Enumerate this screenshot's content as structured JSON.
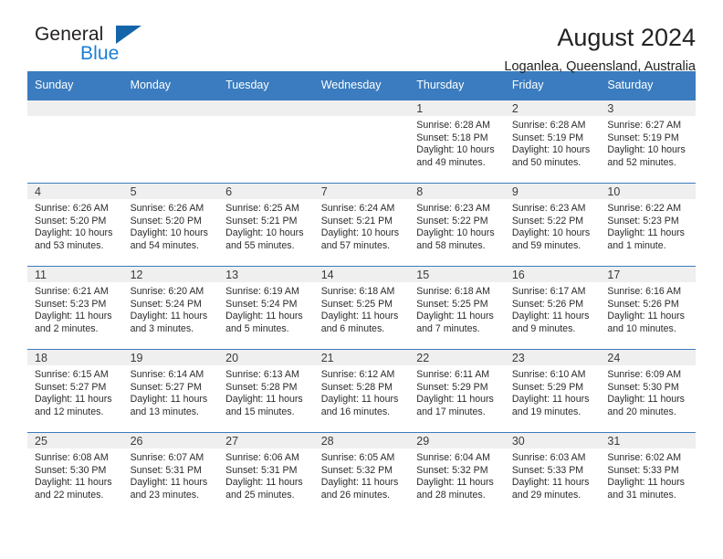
{
  "brand": {
    "name_top": "General",
    "name_bottom": "Blue",
    "triangle_color": "#1464aa",
    "blue_text_color": "#1a7fd4"
  },
  "header": {
    "title": "August 2024",
    "subtitle": "Loganlea, Queensland, Australia",
    "header_bg_color": "#3a7cbf",
    "daynum_band_color": "#efefef"
  },
  "weekday_headers": [
    "Sunday",
    "Monday",
    "Tuesday",
    "Wednesday",
    "Thursday",
    "Friday",
    "Saturday"
  ],
  "labels": {
    "sunrise_prefix": "Sunrise:",
    "sunset_prefix": "Sunset:",
    "daylight_prefix": "Daylight:"
  },
  "weeks": [
    [
      {
        "day": "",
        "line1": "",
        "line2": "",
        "line3": "",
        "line4": ""
      },
      {
        "day": "",
        "line1": "",
        "line2": "",
        "line3": "",
        "line4": ""
      },
      {
        "day": "",
        "line1": "",
        "line2": "",
        "line3": "",
        "line4": ""
      },
      {
        "day": "",
        "line1": "",
        "line2": "",
        "line3": "",
        "line4": ""
      },
      {
        "day": "1",
        "line1": "Sunrise: 6:28 AM",
        "line2": "Sunset: 5:18 PM",
        "line3": "Daylight: 10 hours",
        "line4": "and 49 minutes."
      },
      {
        "day": "2",
        "line1": "Sunrise: 6:28 AM",
        "line2": "Sunset: 5:19 PM",
        "line3": "Daylight: 10 hours",
        "line4": "and 50 minutes."
      },
      {
        "day": "3",
        "line1": "Sunrise: 6:27 AM",
        "line2": "Sunset: 5:19 PM",
        "line3": "Daylight: 10 hours",
        "line4": "and 52 minutes."
      }
    ],
    [
      {
        "day": "4",
        "line1": "Sunrise: 6:26 AM",
        "line2": "Sunset: 5:20 PM",
        "line3": "Daylight: 10 hours",
        "line4": "and 53 minutes."
      },
      {
        "day": "5",
        "line1": "Sunrise: 6:26 AM",
        "line2": "Sunset: 5:20 PM",
        "line3": "Daylight: 10 hours",
        "line4": "and 54 minutes."
      },
      {
        "day": "6",
        "line1": "Sunrise: 6:25 AM",
        "line2": "Sunset: 5:21 PM",
        "line3": "Daylight: 10 hours",
        "line4": "and 55 minutes."
      },
      {
        "day": "7",
        "line1": "Sunrise: 6:24 AM",
        "line2": "Sunset: 5:21 PM",
        "line3": "Daylight: 10 hours",
        "line4": "and 57 minutes."
      },
      {
        "day": "8",
        "line1": "Sunrise: 6:23 AM",
        "line2": "Sunset: 5:22 PM",
        "line3": "Daylight: 10 hours",
        "line4": "and 58 minutes."
      },
      {
        "day": "9",
        "line1": "Sunrise: 6:23 AM",
        "line2": "Sunset: 5:22 PM",
        "line3": "Daylight: 10 hours",
        "line4": "and 59 minutes."
      },
      {
        "day": "10",
        "line1": "Sunrise: 6:22 AM",
        "line2": "Sunset: 5:23 PM",
        "line3": "Daylight: 11 hours",
        "line4": "and 1 minute."
      }
    ],
    [
      {
        "day": "11",
        "line1": "Sunrise: 6:21 AM",
        "line2": "Sunset: 5:23 PM",
        "line3": "Daylight: 11 hours",
        "line4": "and 2 minutes."
      },
      {
        "day": "12",
        "line1": "Sunrise: 6:20 AM",
        "line2": "Sunset: 5:24 PM",
        "line3": "Daylight: 11 hours",
        "line4": "and 3 minutes."
      },
      {
        "day": "13",
        "line1": "Sunrise: 6:19 AM",
        "line2": "Sunset: 5:24 PM",
        "line3": "Daylight: 11 hours",
        "line4": "and 5 minutes."
      },
      {
        "day": "14",
        "line1": "Sunrise: 6:18 AM",
        "line2": "Sunset: 5:25 PM",
        "line3": "Daylight: 11 hours",
        "line4": "and 6 minutes."
      },
      {
        "day": "15",
        "line1": "Sunrise: 6:18 AM",
        "line2": "Sunset: 5:25 PM",
        "line3": "Daylight: 11 hours",
        "line4": "and 7 minutes."
      },
      {
        "day": "16",
        "line1": "Sunrise: 6:17 AM",
        "line2": "Sunset: 5:26 PM",
        "line3": "Daylight: 11 hours",
        "line4": "and 9 minutes."
      },
      {
        "day": "17",
        "line1": "Sunrise: 6:16 AM",
        "line2": "Sunset: 5:26 PM",
        "line3": "Daylight: 11 hours",
        "line4": "and 10 minutes."
      }
    ],
    [
      {
        "day": "18",
        "line1": "Sunrise: 6:15 AM",
        "line2": "Sunset: 5:27 PM",
        "line3": "Daylight: 11 hours",
        "line4": "and 12 minutes."
      },
      {
        "day": "19",
        "line1": "Sunrise: 6:14 AM",
        "line2": "Sunset: 5:27 PM",
        "line3": "Daylight: 11 hours",
        "line4": "and 13 minutes."
      },
      {
        "day": "20",
        "line1": "Sunrise: 6:13 AM",
        "line2": "Sunset: 5:28 PM",
        "line3": "Daylight: 11 hours",
        "line4": "and 15 minutes."
      },
      {
        "day": "21",
        "line1": "Sunrise: 6:12 AM",
        "line2": "Sunset: 5:28 PM",
        "line3": "Daylight: 11 hours",
        "line4": "and 16 minutes."
      },
      {
        "day": "22",
        "line1": "Sunrise: 6:11 AM",
        "line2": "Sunset: 5:29 PM",
        "line3": "Daylight: 11 hours",
        "line4": "and 17 minutes."
      },
      {
        "day": "23",
        "line1": "Sunrise: 6:10 AM",
        "line2": "Sunset: 5:29 PM",
        "line3": "Daylight: 11 hours",
        "line4": "and 19 minutes."
      },
      {
        "day": "24",
        "line1": "Sunrise: 6:09 AM",
        "line2": "Sunset: 5:30 PM",
        "line3": "Daylight: 11 hours",
        "line4": "and 20 minutes."
      }
    ],
    [
      {
        "day": "25",
        "line1": "Sunrise: 6:08 AM",
        "line2": "Sunset: 5:30 PM",
        "line3": "Daylight: 11 hours",
        "line4": "and 22 minutes."
      },
      {
        "day": "26",
        "line1": "Sunrise: 6:07 AM",
        "line2": "Sunset: 5:31 PM",
        "line3": "Daylight: 11 hours",
        "line4": "and 23 minutes."
      },
      {
        "day": "27",
        "line1": "Sunrise: 6:06 AM",
        "line2": "Sunset: 5:31 PM",
        "line3": "Daylight: 11 hours",
        "line4": "and 25 minutes."
      },
      {
        "day": "28",
        "line1": "Sunrise: 6:05 AM",
        "line2": "Sunset: 5:32 PM",
        "line3": "Daylight: 11 hours",
        "line4": "and 26 minutes."
      },
      {
        "day": "29",
        "line1": "Sunrise: 6:04 AM",
        "line2": "Sunset: 5:32 PM",
        "line3": "Daylight: 11 hours",
        "line4": "and 28 minutes."
      },
      {
        "day": "30",
        "line1": "Sunrise: 6:03 AM",
        "line2": "Sunset: 5:33 PM",
        "line3": "Daylight: 11 hours",
        "line4": "and 29 minutes."
      },
      {
        "day": "31",
        "line1": "Sunrise: 6:02 AM",
        "line2": "Sunset: 5:33 PM",
        "line3": "Daylight: 11 hours",
        "line4": "and 31 minutes."
      }
    ]
  ]
}
